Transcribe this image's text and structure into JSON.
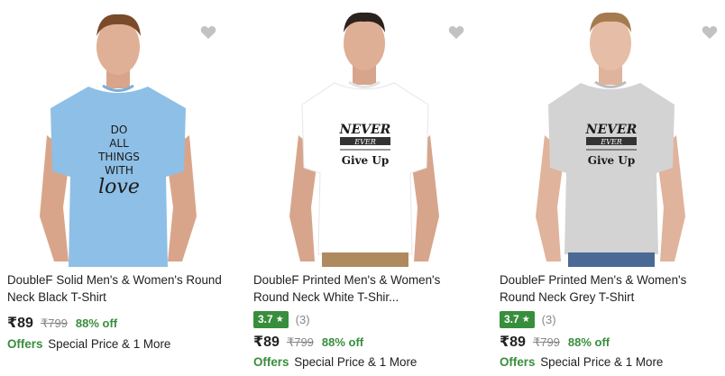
{
  "colors": {
    "rating_green": "#388e3c",
    "off_green": "#388e3c",
    "mrp_grey": "#878787",
    "wishlist_grey": "#c2c2c2"
  },
  "products": [
    {
      "title": "DoubleF Solid Men's & Women's Round\nNeck Black T-Shirt",
      "rating": "",
      "rating_count": "",
      "price": "₹89",
      "mrp": "₹799",
      "discount": "88% off",
      "offers_label": "Offers",
      "offers_text": "Special Price & 1 More",
      "shirt_color": "#8ebfe6",
      "print_lines": [
        "DO",
        "ALL",
        "THINGS",
        "WITH",
        "love"
      ]
    },
    {
      "title": "DoubleF Printed Men's & Women's\nRound Neck White T-Shir...",
      "rating": "3.7",
      "rating_count": "(3)",
      "price": "₹89",
      "mrp": "₹799",
      "discount": "88% off",
      "offers_label": "Offers",
      "offers_text": "Special Price & 1 More",
      "shirt_color": "#ffffff",
      "print_lines": [
        "NEVER",
        "EVER",
        "Give Up"
      ]
    },
    {
      "title": "DoubleF Printed Men's & Women's\nRound Neck Grey T-Shirt",
      "rating": "3.7",
      "rating_count": "(3)",
      "price": "₹89",
      "mrp": "₹799",
      "discount": "88% off",
      "offers_label": "Offers",
      "offers_text": "Special Price & 1 More",
      "shirt_color": "#d3d3d3",
      "print_lines": [
        "NEVER",
        "EVER",
        "Give Up"
      ]
    }
  ]
}
